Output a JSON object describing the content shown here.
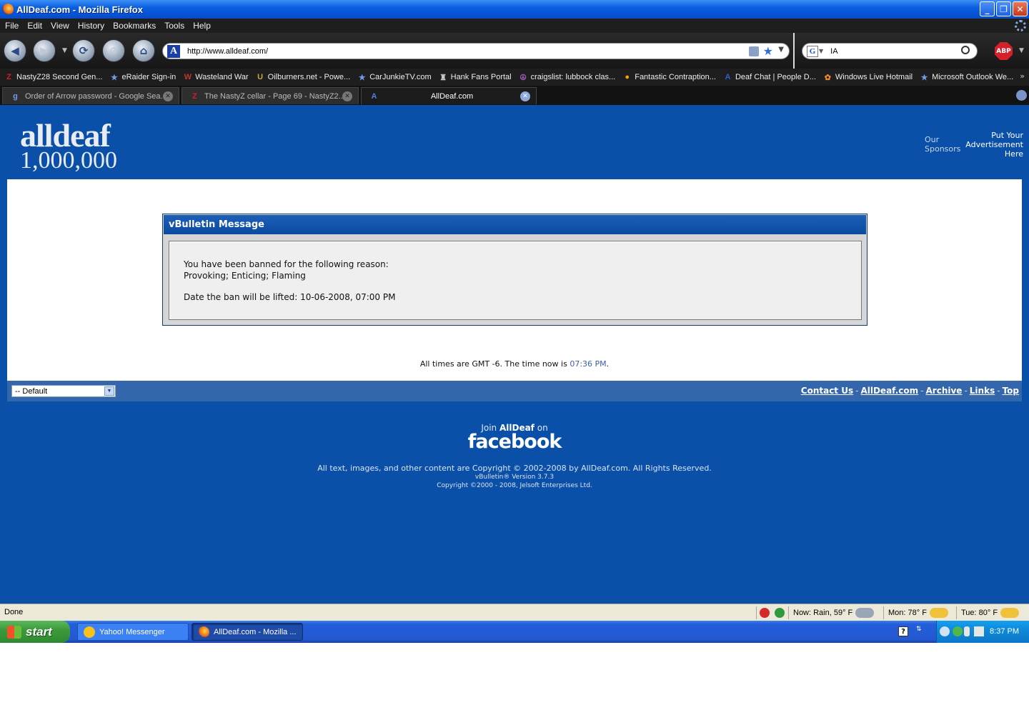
{
  "window": {
    "title": "AllDeaf.com - Mozilla Firefox",
    "minimize": "_",
    "restore": "❐",
    "close": "✕"
  },
  "menu": [
    "File",
    "Edit",
    "View",
    "History",
    "Bookmarks",
    "Tools",
    "Help"
  ],
  "nav": {
    "url": "http://www.alldeaf.com/",
    "search_value": "IA",
    "search_engine_icon": "G",
    "adblock_label": "ABP"
  },
  "bookmarks": [
    {
      "label": "NastyZ28 Second Gen...",
      "icon": "Z",
      "color": "#d0202a"
    },
    {
      "label": "eRaider Sign-in",
      "icon": "★",
      "color": "#6f9be8"
    },
    {
      "label": "Wasteland War",
      "icon": "W",
      "color": "#c0392b"
    },
    {
      "label": "Oilburners.net - Powe...",
      "icon": "U",
      "color": "#c9a93a"
    },
    {
      "label": "CarJunkieTV.com",
      "icon": "★",
      "color": "#6f9be8"
    },
    {
      "label": "Hank Fans Portal",
      "icon": "♜",
      "color": "#c9c9c9"
    },
    {
      "label": "craigslist: lubbock clas...",
      "icon": "☮",
      "color": "#9b59b6"
    },
    {
      "label": "Fantastic Contraption...",
      "icon": "●",
      "color": "#f1a10a"
    },
    {
      "label": "Deaf Chat | People D...",
      "icon": "A",
      "color": "#2b5fd0"
    },
    {
      "label": "Windows Live Hotmail",
      "icon": "✿",
      "color": "#f08a2a"
    },
    {
      "label": "Microsoft Outlook We...",
      "icon": "★",
      "color": "#6f9be8"
    }
  ],
  "bookmarks_more": "»",
  "tabs": [
    {
      "title": "Order of Arrow password - Google Sea...",
      "icon": "g",
      "active": false
    },
    {
      "title": "The NastyZ cellar - Page 69 - NastyZ2...",
      "icon": "Z",
      "active": false
    },
    {
      "title": "AllDeaf.com",
      "icon": "A",
      "active": true
    }
  ],
  "tab_close": "✕",
  "site": {
    "logo_line1": "alldeaf",
    "logo_line2": "1,000,000",
    "sponsors_label": "Our Sponsors",
    "ad_link": "Put Your Advertisement Here"
  },
  "message": {
    "header": "vBulletin Message",
    "line1": "You have been banned for the following reason:",
    "line2": "Provoking; Enticing; Flaming",
    "line3": "Date the ban will be lifted: 10-06-2008, 07:00 PM"
  },
  "time": {
    "prefix": "All times are GMT -6. The time now is ",
    "value": "07:36 PM",
    "suffix": "."
  },
  "footer": {
    "style_select": "-- Default",
    "links": [
      "Contact Us",
      "AllDeaf.com",
      "Archive",
      "Links",
      "Top"
    ],
    "join_prefix": "Join ",
    "join_brand": "AllDeaf",
    "join_suffix": " on",
    "facebook": "facebook",
    "copyright": "All text, images, and other content are Copyright © 2002-2008 by AllDeaf.com. All Rights Reserved.",
    "vb_version": "vBulletin® Version 3.7.3",
    "vb_copyright": "Copyright ©2000 - 2008, Jelsoft Enterprises Ltd."
  },
  "status": {
    "text": "Done",
    "weather_now": "Now: Rain, 59° F",
    "weather_mon": "Mon: 78° F",
    "weather_tue": "Tue: 80° F"
  },
  "taskbar": {
    "start": "start",
    "items": [
      "Yahoo! Messenger",
      "AllDeaf.com - Mozilla ..."
    ],
    "clock": "8:37 PM"
  }
}
